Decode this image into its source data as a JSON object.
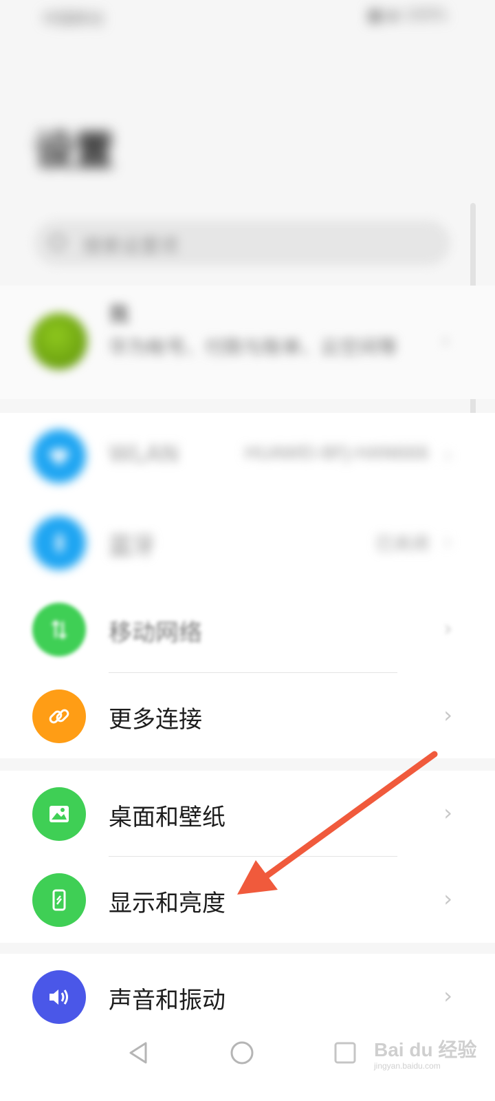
{
  "status_bar": {
    "left_text": "中国移动",
    "right_text": "■ ◆ 100%"
  },
  "header": {
    "title": "设置"
  },
  "search": {
    "placeholder": "搜索设置项"
  },
  "account": {
    "name": "我",
    "subtitle": "华为帐号、付款与账单、云空间等"
  },
  "connections": {
    "items": [
      {
        "label": "WLAN",
        "value": "HUAWEI-BFJ-HAN666",
        "icon": "wifi-icon"
      },
      {
        "label": "蓝牙",
        "value": "已关闭",
        "icon": "bluetooth-icon"
      },
      {
        "label": "移动网络",
        "value": "",
        "icon": "mobile-network-icon"
      },
      {
        "label": "更多连接",
        "value": "",
        "icon": "link-icon"
      }
    ]
  },
  "display_group": {
    "items": [
      {
        "label": "桌面和壁纸",
        "icon": "wallpaper-icon"
      },
      {
        "label": "显示和亮度",
        "icon": "display-brightness-icon"
      }
    ]
  },
  "sound_group": {
    "items": [
      {
        "label": "声音和振动",
        "icon": "volume-icon"
      }
    ]
  },
  "chevron": "›",
  "watermark": {
    "brand": "Bai du 经验",
    "url": "jingyan.baidu.com"
  },
  "colors": {
    "wifi": "#1ea5f2",
    "bluetooth": "#1ea5f2",
    "mobile_network": "#3fcf55",
    "more_connections": "#ff9d15",
    "wallpaper": "#3fcf55",
    "display": "#3fcf55",
    "sound": "#4a57e8",
    "annotation_arrow": "#f05a3c"
  }
}
